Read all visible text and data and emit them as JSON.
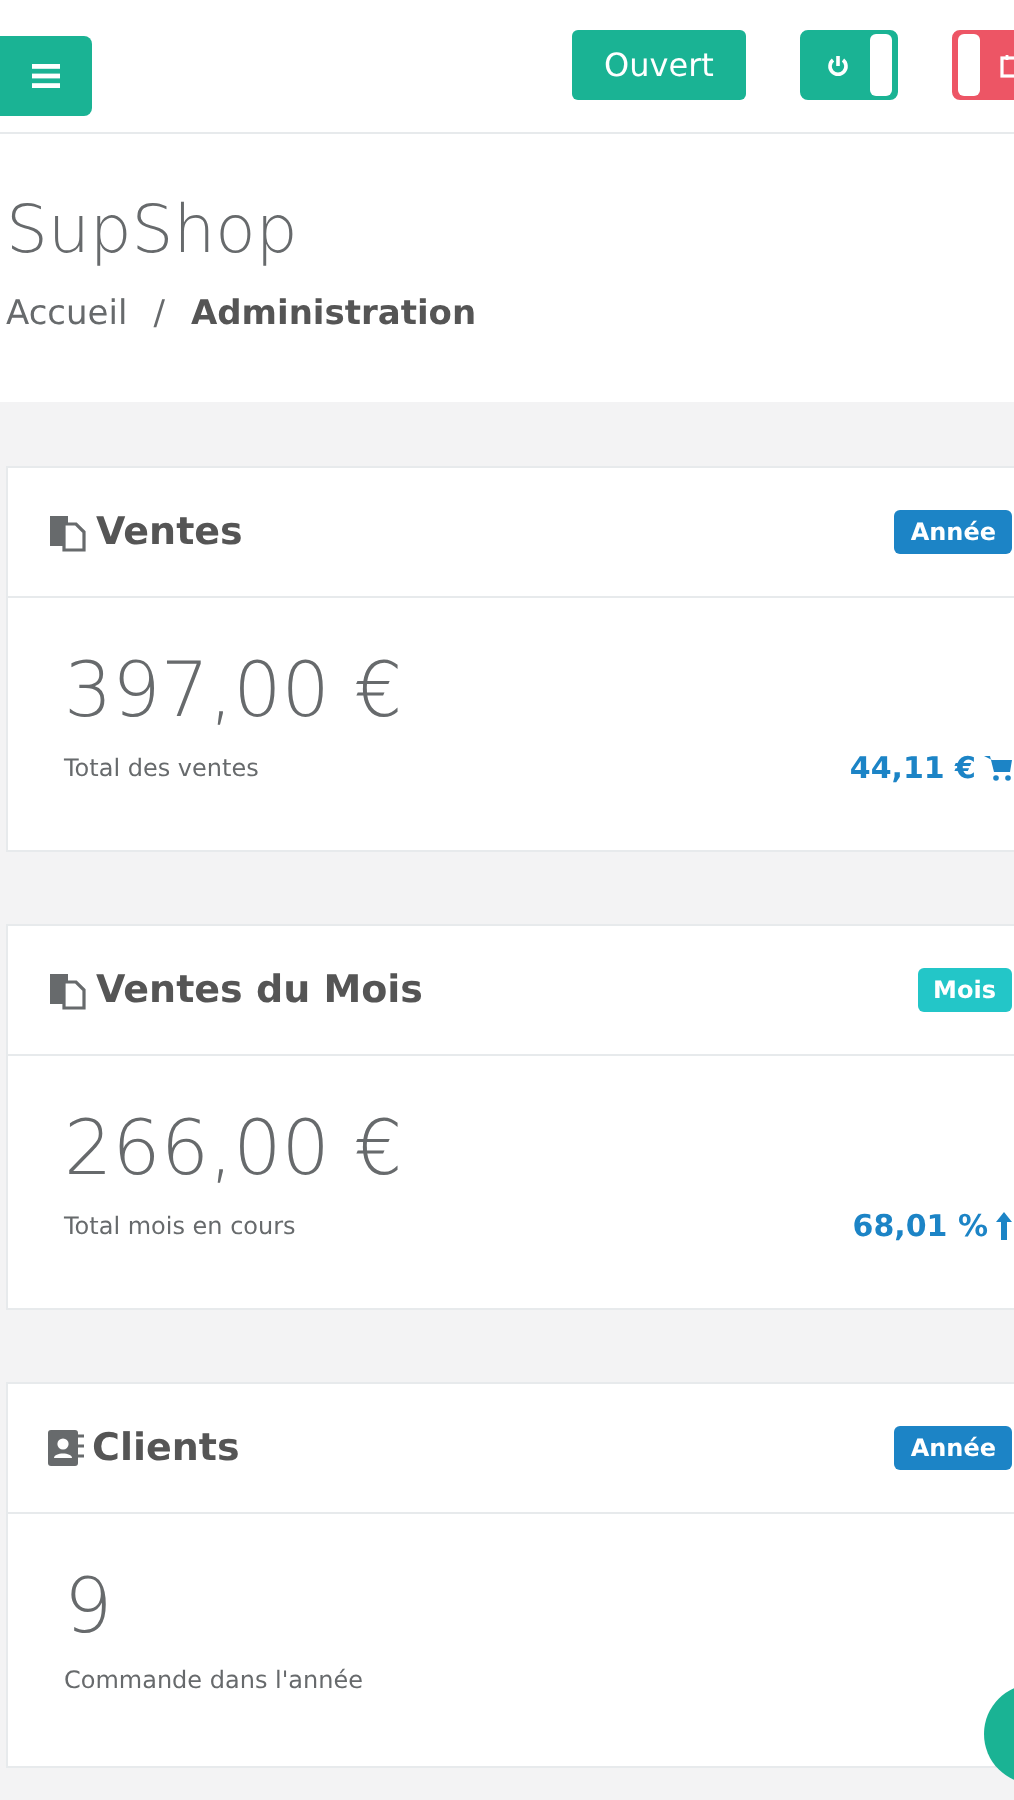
{
  "topbar": {
    "status_button": "Ouvert",
    "toggles": [
      {
        "kind": "power",
        "on": true
      },
      {
        "kind": "calendar",
        "on": false
      }
    ]
  },
  "page": {
    "title": "SupShop",
    "separator": "/",
    "breadcrumb": [
      {
        "label": "Accueil",
        "selected": false
      },
      {
        "label": "Administration",
        "selected": true
      }
    ]
  },
  "cards": [
    {
      "title": "Ventes",
      "badge": {
        "label": "Année",
        "color": "#1c84c6"
      },
      "value": "397,00 €",
      "caption": "Total des ventes",
      "stat": "44,11 €"
    },
    {
      "title": "Ventes du Mois",
      "badge": {
        "label": "Mois",
        "color": "#23c6c8"
      },
      "value": "266,00 €",
      "caption": "Total mois en cours",
      "stat": "68,01 %"
    },
    {
      "title": "Clients",
      "badge": {
        "label": "Année",
        "color": "#1c84c6"
      },
      "value": "9",
      "caption": "Commande dans l'année"
    }
  ]
}
